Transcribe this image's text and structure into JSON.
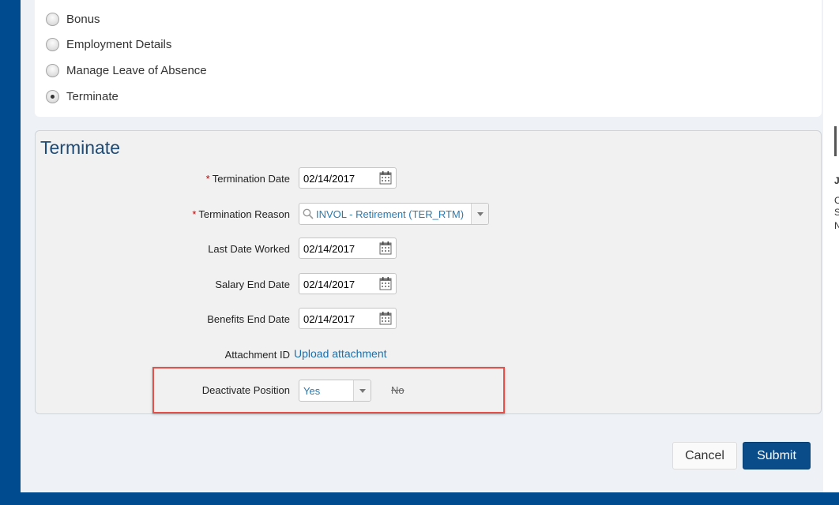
{
  "action_options": [
    {
      "label": "Bonus",
      "selected": false
    },
    {
      "label": "Employment Details",
      "selected": false
    },
    {
      "label": "Manage Leave of Absence",
      "selected": false
    },
    {
      "label": "Terminate",
      "selected": true
    }
  ],
  "form": {
    "title": "Terminate",
    "required_marker": "*",
    "termination_date": {
      "label": "Termination Date",
      "value": "02/14/2017"
    },
    "termination_reason": {
      "label": "Termination Reason",
      "value": "INVOL - Retirement (TER_RTM)"
    },
    "last_date_worked": {
      "label": "Last Date Worked",
      "value": "02/14/2017"
    },
    "salary_end_date": {
      "label": "Salary End Date",
      "value": "02/14/2017"
    },
    "benefits_end_date": {
      "label": "Benefits End Date",
      "value": "02/14/2017"
    },
    "attachment": {
      "label": "Attachment ID",
      "link_text": "Upload attachment"
    },
    "deactivate_position": {
      "label": "Deactivate Position",
      "value": "Yes",
      "alternate_option": "No"
    }
  },
  "buttons": {
    "cancel": "Cancel",
    "submit": "Submit"
  },
  "side_panel_letters": [
    "J",
    "C",
    "S",
    "N"
  ],
  "colors": {
    "brand": "#004a8f",
    "submit_button": "#0a4c8a",
    "link": "#1a6fae",
    "highlight": "#e4504a"
  },
  "icons": {
    "date_picker": "calendar-icon",
    "reason_search": "search-icon",
    "dropdown": "chevron-down-icon"
  }
}
